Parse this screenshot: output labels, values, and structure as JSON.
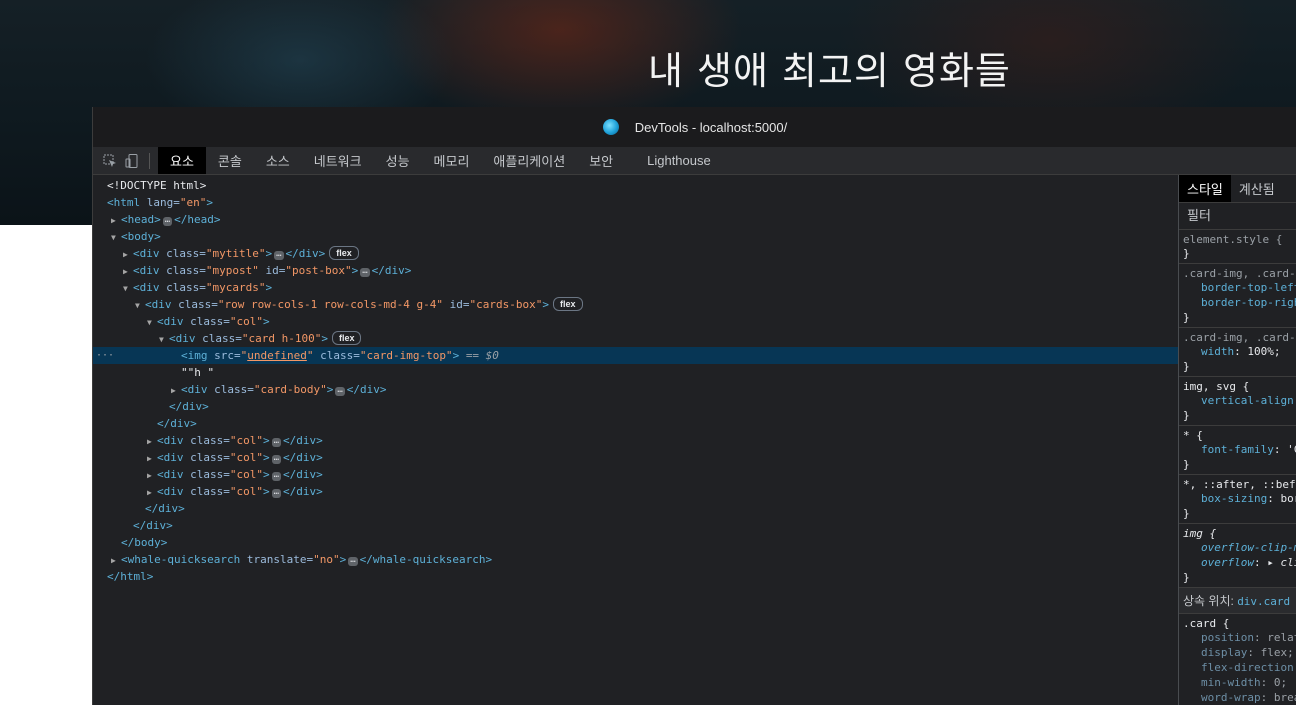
{
  "hero": {
    "title": "내 생애 최고의 영화들"
  },
  "devtools": {
    "window_title": "DevTools - localhost:5000/",
    "tabs": [
      "요소",
      "콘솔",
      "소스",
      "네트워크",
      "성능",
      "메모리",
      "애플리케이션",
      "보안",
      "Lighthouse"
    ],
    "active_tab": "요소",
    "selected_suffix": "== $0",
    "dom": {
      "doctype": "<!DOCTYPE html>",
      "html_open": "<html",
      "html_lang_attr": " lang=",
      "html_lang_val": "\"en\"",
      "head": "<head>",
      "head_close": "</head>",
      "body": "<body>",
      "body_close": "</body>",
      "html_close": "</html>",
      "div_open": "<div",
      "div_close": "</div>",
      "img_open": "<img",
      "class_attr": " class=",
      "id_attr": " id=",
      "src_attr": " src=",
      "gt": ">",
      "mytitle": "\"mytitle\"",
      "mypost": "\"mypost\"",
      "post_box": "\"post-box\"",
      "mycards": "\"mycards\"",
      "row_class": "\"row row-cols-1 row-cols-md-4 g-4\"",
      "cards_box": "\"cards-box\"",
      "col": "\"col\"",
      "card": "\"card h-100\"",
      "img_src": "undefined",
      "img_class": "\"card-img-top\"",
      "text_node": "\"\"h \"",
      "card_body": "\"card-body\"",
      "whale_open": "<whale-quicksearch",
      "translate_attr": " translate=",
      "translate_val": "\"no\"",
      "whale_close": "</whale-quicksearch>",
      "flex_badge": "flex",
      "ellipsis": "…"
    },
    "styles_panel": {
      "tabs": [
        "스타일",
        "계산됨"
      ],
      "filter_placeholder": "필터",
      "rules": [
        {
          "selector": "element.style {",
          "props": []
        },
        {
          "selector": ".card-img, .card-i",
          "props": [
            [
              "border-top-left",
              ""
            ],
            [
              "border-top-righ",
              ""
            ]
          ]
        },
        {
          "selector": ".card-img, .card-",
          "props": [
            [
              "width",
              "100%;"
            ]
          ]
        },
        {
          "selector": "img, svg {",
          "props": [
            [
              "vertical-align",
              ""
            ]
          ]
        },
        {
          "selector": "* {",
          "props": [
            [
              "font-family",
              "'C"
            ]
          ]
        },
        {
          "selector": "*, ::after, ::befo",
          "props": [
            [
              "box-sizing",
              "bor"
            ]
          ]
        },
        {
          "selector": "img {",
          "props": [
            [
              "overflow-clip-m",
              ""
            ],
            [
              "overflow",
              "clip"
            ]
          ]
        }
      ],
      "inherited_label": "상속 위치:",
      "inherited_link": "div.card",
      "card_rule": {
        "selector": ".card {",
        "props": [
          [
            "position",
            "relat"
          ],
          [
            "display",
            "flex;"
          ],
          [
            "flex-direction",
            ""
          ],
          [
            "min-width",
            "0;"
          ],
          [
            "word-wrap",
            "brea"
          ]
        ]
      }
    }
  }
}
